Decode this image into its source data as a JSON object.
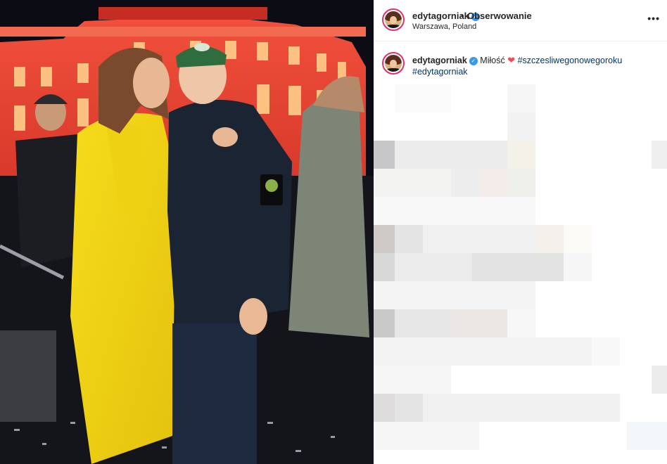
{
  "post": {
    "username": "edytagorniak",
    "follow_label": "Obserwowanie",
    "separator": "•",
    "location": "Warszawa, Poland",
    "more_label": "•••"
  },
  "caption": {
    "username": "edytagorniak",
    "text": "Miłość",
    "heart": "❤",
    "hashtag1": "#szczesliwegonowegoroku",
    "hashtag2": "#edytagorniak"
  },
  "icons": {
    "verified": "verified-badge-icon",
    "more": "more-options-icon"
  },
  "colors": {
    "verified": "#3897f0",
    "hashtag": "#00376b",
    "heart": "#ed4956",
    "avatar_ring": "#e1306c"
  }
}
